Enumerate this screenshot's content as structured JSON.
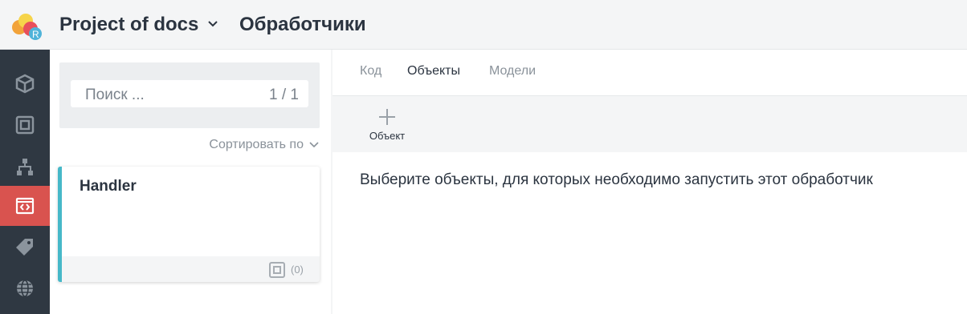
{
  "header": {
    "project_name": "Project of docs",
    "section_title": "Обработчики"
  },
  "sidebar": {
    "items": [
      {
        "icon": "cube-icon",
        "active": false
      },
      {
        "icon": "square-frame-icon",
        "active": false
      },
      {
        "icon": "hierarchy-icon",
        "active": false
      },
      {
        "icon": "code-window-icon",
        "active": true
      },
      {
        "icon": "tag-icon",
        "active": false
      },
      {
        "icon": "globe-icon",
        "active": false
      }
    ],
    "active_color": "#d9534f"
  },
  "list": {
    "search_placeholder": "Поиск ...",
    "search_counter": "1 / 1",
    "sort_label": "Сортировать по",
    "cards": [
      {
        "title": "Handler",
        "count": "(0)"
      }
    ],
    "accent_color": "#46b8c8"
  },
  "main": {
    "tabs": [
      {
        "label": "Код",
        "active": false
      },
      {
        "label": "Объекты",
        "active": true
      },
      {
        "label": "Модели",
        "active": false
      }
    ],
    "toolbar": {
      "add_label": "Объект"
    },
    "hint": "Выберите объекты, для которых необходимо запустить этот обработчик"
  }
}
